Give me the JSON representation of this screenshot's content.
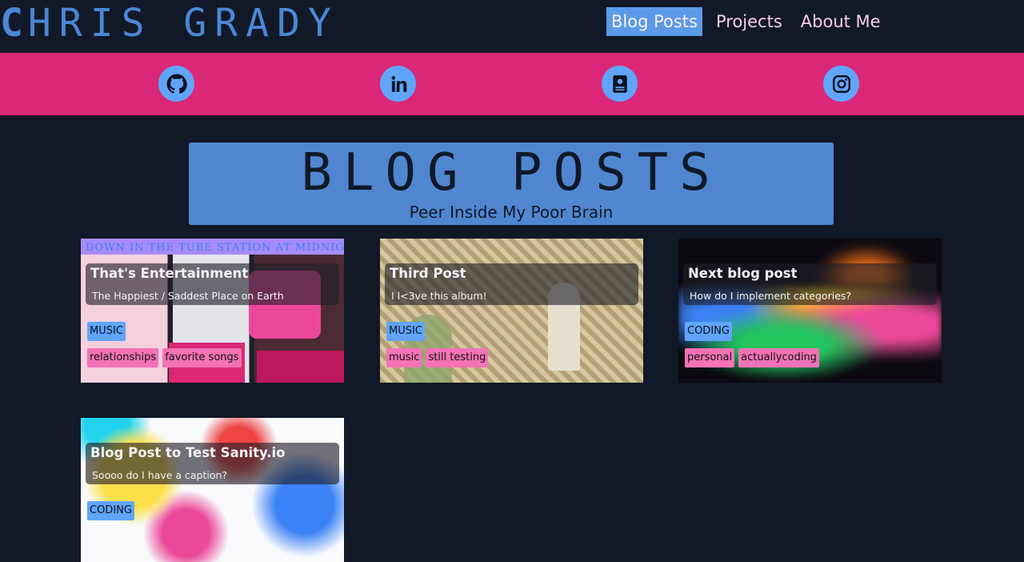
{
  "header": {
    "logo_first": "C",
    "logo_rest": "HRIS GRADY",
    "nav": [
      {
        "label": "Blog Posts",
        "active": true
      },
      {
        "label": "Projects",
        "active": false
      },
      {
        "label": "About Me",
        "active": false
      }
    ]
  },
  "social": [
    {
      "icon": "github-icon"
    },
    {
      "icon": "linkedin-icon"
    },
    {
      "icon": "resume-icon"
    },
    {
      "icon": "instagram-icon"
    }
  ],
  "banner": {
    "title": "BLOG POSTS",
    "subtitle": "Peer Inside My Poor Brain"
  },
  "posts": [
    {
      "title": "That's Entertainment",
      "subtitle": "The Happiest / Saddest Place on Earth",
      "category": "MUSIC",
      "tags": [
        "relationships",
        "favorite songs"
      ],
      "image_text": "DOWN IN THE TUBE STATION AT MIDNIGHT"
    },
    {
      "title": "Third Post",
      "subtitle": "I l<3ve this album!",
      "category": "MUSIC",
      "tags": [
        "music",
        "still testing"
      ]
    },
    {
      "title": "Next blog post",
      "subtitle": "How do I implement categories?",
      "category": "CODING",
      "tags": [
        "personal",
        "actuallycoding"
      ]
    },
    {
      "title": "Blog Post to Test Sanity.io",
      "subtitle": "Soooo do I have a caption?",
      "category": "CODING",
      "tags": []
    }
  ],
  "colors": {
    "background": "#111827",
    "social_band": "#db2777",
    "accent_blue": "#60a5fa",
    "tag_pink": "#f472b6",
    "banner_blue": "#4f86cf"
  }
}
